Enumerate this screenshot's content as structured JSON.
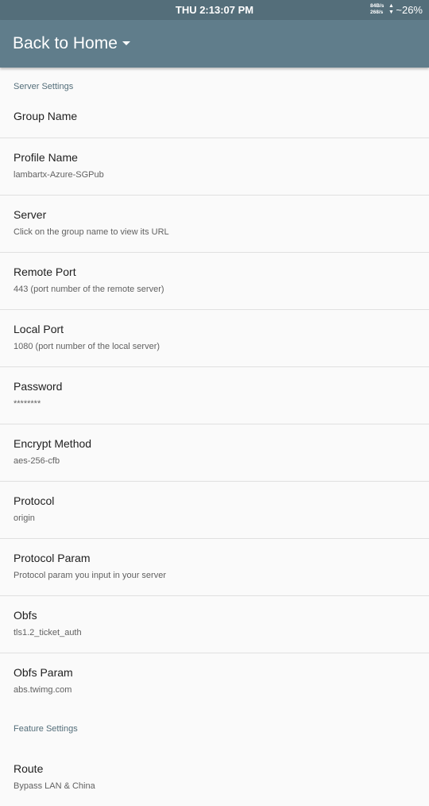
{
  "status_bar": {
    "time": "THU 2:13:07 PM",
    "net_up": "84B/s",
    "net_down": "268/s",
    "battery": "~26%"
  },
  "app_bar": {
    "title": "Back to Home"
  },
  "sections": {
    "server_settings": "Server Settings",
    "feature_settings": "Feature Settings"
  },
  "prefs": [
    {
      "title": "Group Name",
      "summary": ""
    },
    {
      "title": "Profile Name",
      "summary": "lambartx-Azure-SGPub"
    },
    {
      "title": "Server",
      "summary": "Click on the group name to view its URL"
    },
    {
      "title": "Remote Port",
      "summary": "443 (port number of the remote server)"
    },
    {
      "title": "Local Port",
      "summary": "1080 (port number of the local server)"
    },
    {
      "title": "Password",
      "summary": "********"
    },
    {
      "title": "Encrypt Method",
      "summary": "aes-256-cfb"
    },
    {
      "title": "Protocol",
      "summary": "origin"
    },
    {
      "title": "Protocol Param",
      "summary": "Protocol param you input in your server"
    },
    {
      "title": "Obfs",
      "summary": "tls1.2_ticket_auth"
    },
    {
      "title": "Obfs Param",
      "summary": "abs.twimg.com"
    },
    {
      "title": "Route",
      "summary": "Bypass LAN & China"
    }
  ]
}
